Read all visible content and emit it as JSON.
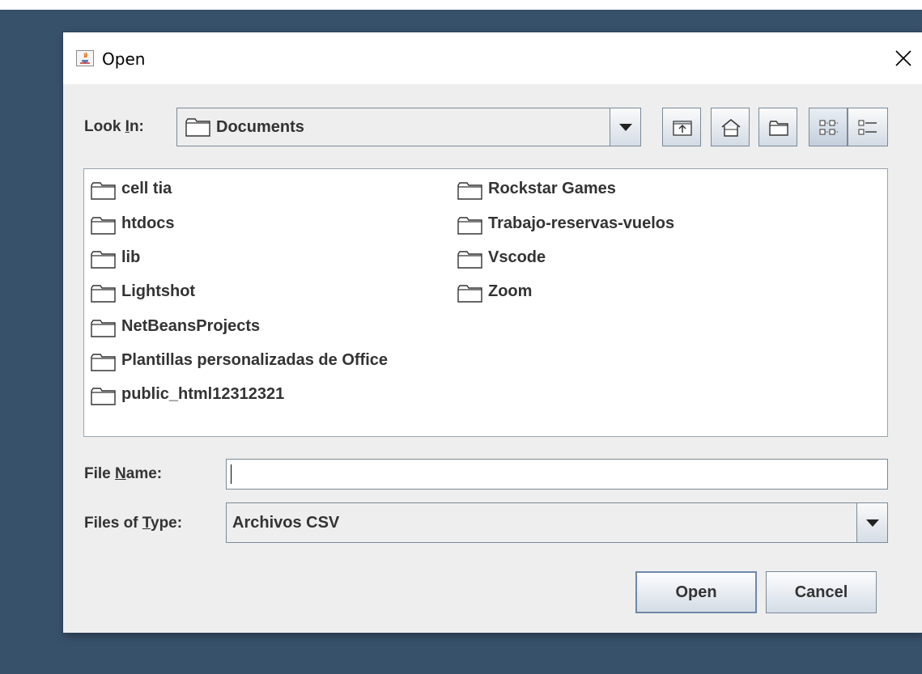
{
  "window": {
    "title": "Open",
    "close_glyph": "✕",
    "icon": "java-cup-icon"
  },
  "look_in": {
    "label_pre": "Look ",
    "label_mn": "I",
    "label_post": "n:",
    "value": "Documents"
  },
  "toolbar": {
    "buttons": [
      "up-one-level",
      "home",
      "new-folder",
      "list-view",
      "details-view"
    ]
  },
  "files": {
    "col1": [
      "cell tia",
      "htdocs",
      "lib",
      "Lightshot",
      "NetBeansProjects",
      "Plantillas personalizadas de Office",
      "public_html12312321"
    ],
    "col2": [
      "Rockstar Games",
      "Trabajo-reservas-vuelos",
      "Vscode",
      "Zoom"
    ]
  },
  "file_name": {
    "label_pre": "File ",
    "label_mn": "N",
    "label_post": "ame:",
    "value": ""
  },
  "file_type": {
    "label_pre": "Files of ",
    "label_mn": "T",
    "label_post": "ype:",
    "value": "Archivos CSV"
  },
  "buttons": {
    "open": "Open",
    "cancel": "Cancel"
  },
  "colors": {
    "desktop": "#38516b",
    "dialog_bg": "#eeeeee",
    "button_border": "#7a8a99",
    "default_button_border": "#6d88a8"
  }
}
